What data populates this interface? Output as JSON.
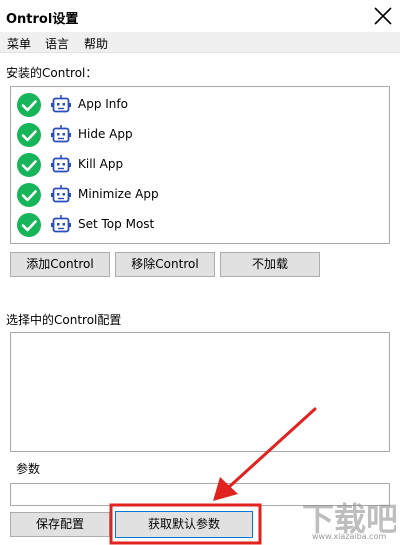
{
  "window": {
    "title": "Ontrol设置"
  },
  "menu": {
    "items": [
      "菜单",
      "语言",
      "帮助"
    ]
  },
  "installed": {
    "label": "安装的Control：",
    "items": [
      {
        "label": "App Info"
      },
      {
        "label": "Hide App"
      },
      {
        "label": "Kill App"
      },
      {
        "label": "Minimize App"
      },
      {
        "label": "Set Top Most"
      }
    ]
  },
  "actions": {
    "add": "添加Control",
    "remove": "移除Control",
    "unload": "不加载"
  },
  "config": {
    "label": "选择中的Control配置",
    "text": ""
  },
  "params": {
    "label": "参数",
    "value": ""
  },
  "footer": {
    "save": "保存配置",
    "defaults": "获取默认参数"
  },
  "watermark": {
    "text": "下载吧",
    "url": "www.xiazaiba.com"
  },
  "colors": {
    "check_green": "#17b559",
    "bot_blue": "#2b4dbb",
    "annotation_red": "#e0231f",
    "primary_border": "#0078d7"
  }
}
